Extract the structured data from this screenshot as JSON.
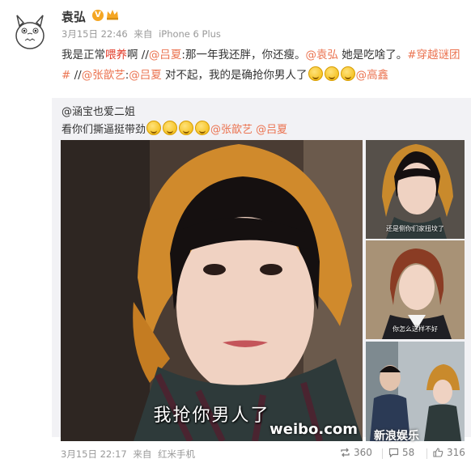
{
  "author": {
    "name": "袁弘",
    "verified": "V",
    "date": "3月15日 22:46",
    "source_prefix": "来自",
    "source": "iPhone 6 Plus"
  },
  "post": {
    "t1": "我是正常",
    "t_hl": "喂养",
    "t2": "啊 //",
    "m1": "@吕夏",
    "t3": ":那一年我还胖，你还瘦。",
    "m2": "@袁弘",
    "t4": " 她是吃啥了。",
    "topic": "#穿越谜团#",
    "t5": " //",
    "m3": "@张歆艺",
    "t6": ":",
    "m4": "@吕夏",
    "t7": " 对不起，我的是确抢你男人了",
    "m5": "@高鑫"
  },
  "repost": {
    "author": "@涵宝也爱二姐",
    "text": "看你们撕逼挺带劲",
    "m1": "@张歆艺",
    "m2": "@吕夏"
  },
  "images": {
    "main_caption": "我抢你男人了",
    "watermark": "weibo.com",
    "s1_caption": "还是侧你们家扭坟了",
    "s2_caption": "你怎么这样不好",
    "sina_watermark": "新浪娱乐"
  },
  "footer": {
    "date": "3月15日 22:17",
    "source_prefix": "来自",
    "source": "红米手机",
    "reposts": "360",
    "comments": "58",
    "likes": "316"
  },
  "colors": {
    "mention": "#eb7350",
    "highlight": "#e23d2b",
    "repost_bg": "#f2f2f5"
  }
}
